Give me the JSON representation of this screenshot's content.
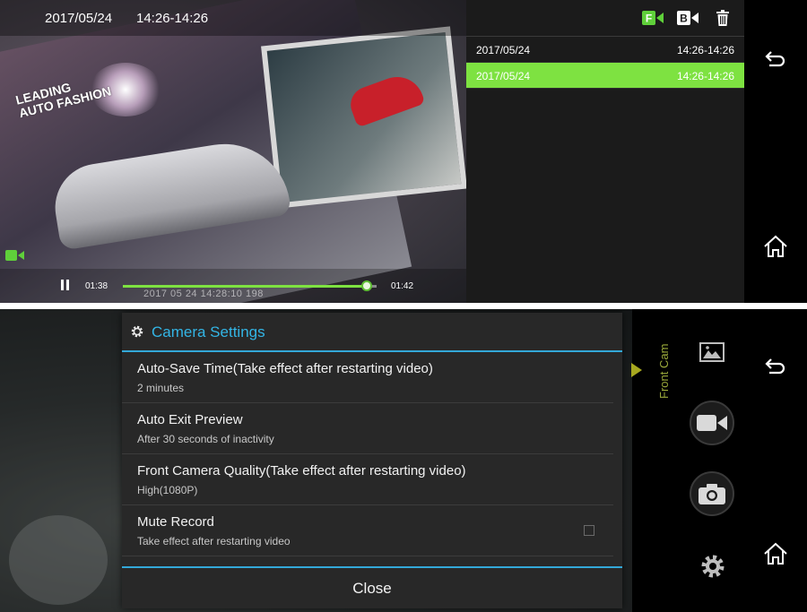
{
  "player": {
    "date": "2017/05/24",
    "time_range": "14:26-14:26",
    "poster_line1": "LEADING",
    "poster_line2": "AUTO FASHION",
    "current_time": "01:38",
    "end_time": "01:42",
    "progress": 0.96,
    "stamp": "2017 05 24 14:28:10 198"
  },
  "files": {
    "front_label": "F",
    "back_label": "B",
    "items": [
      {
        "date": "2017/05/24",
        "time": "14:26-14:26",
        "selected": false
      },
      {
        "date": "2017/05/24",
        "time": "14:26-14:26",
        "selected": true
      }
    ],
    "accent": "#7ee241"
  },
  "settings": {
    "title": "Camera Settings",
    "items": [
      {
        "title": "Auto-Save Time(Take effect after restarting video)",
        "summary": "2 minutes"
      },
      {
        "title": "Auto Exit Preview",
        "summary": "After 30 seconds of inactivity"
      },
      {
        "title": "Front Camera Quality(Take effect after restarting video)",
        "summary": "High(1080P)"
      },
      {
        "title": "Mute Record",
        "summary": "Take effect after restarting video",
        "checked": false
      }
    ],
    "close_label": "Close",
    "accent": "#33b5e5"
  },
  "camera_panel": {
    "label": "Front Cam"
  }
}
